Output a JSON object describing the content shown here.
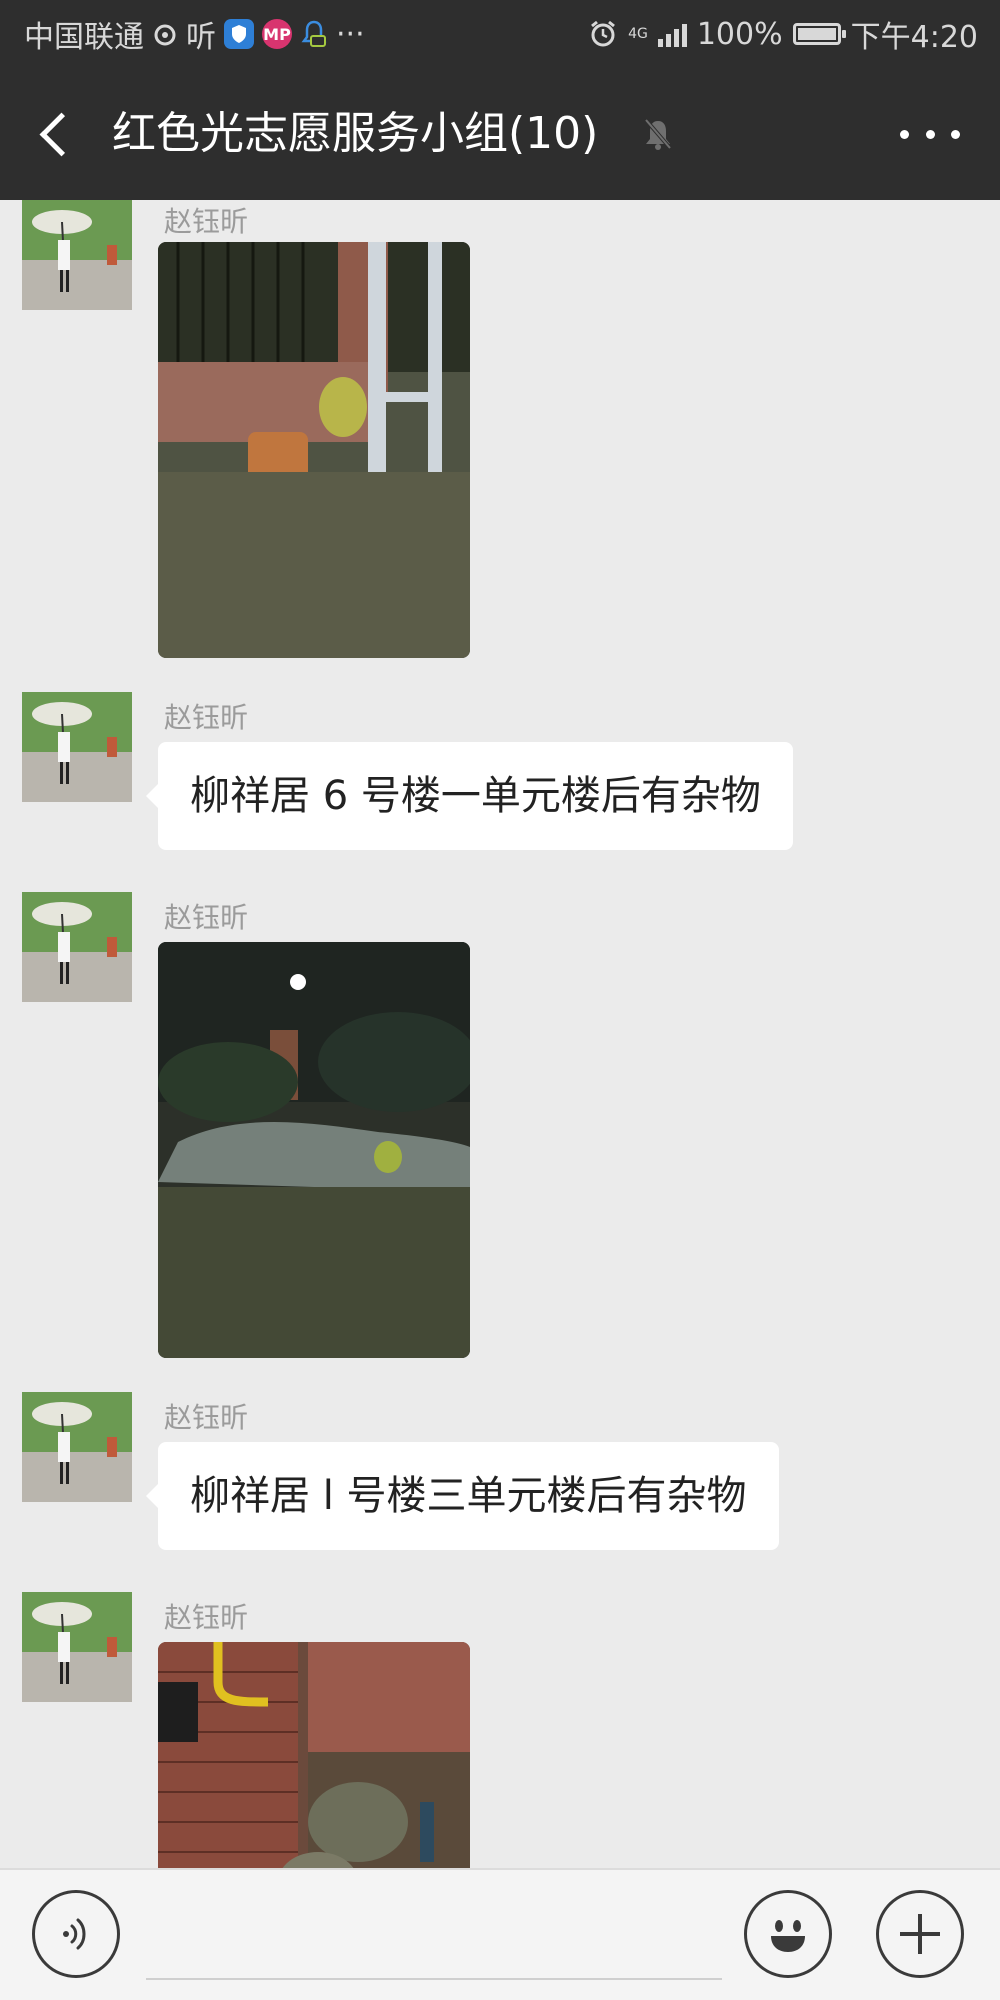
{
  "status_bar": {
    "carrier": "中国联通",
    "ting": "听",
    "mp_badge": "MP",
    "network": "4G",
    "battery": "100%",
    "time": "下午4:20",
    "overflow": "···"
  },
  "header": {
    "title": "红色光志愿服务小组(10)"
  },
  "messages": [
    {
      "type": "image",
      "sender": "赵钰昕"
    },
    {
      "type": "text",
      "sender": "赵钰昕",
      "text": "柳祥居 6 号楼一单元楼后有杂物"
    },
    {
      "type": "image",
      "sender": "赵钰昕"
    },
    {
      "type": "text",
      "sender": "赵钰昕",
      "text": "柳祥居 l 号楼三单元楼后有杂物"
    },
    {
      "type": "image",
      "sender": "赵钰昕"
    }
  ],
  "input_bar": {
    "voice_icon": "voice-icon",
    "emoji_icon": "emoji-icon",
    "add_icon": "plus-icon"
  }
}
